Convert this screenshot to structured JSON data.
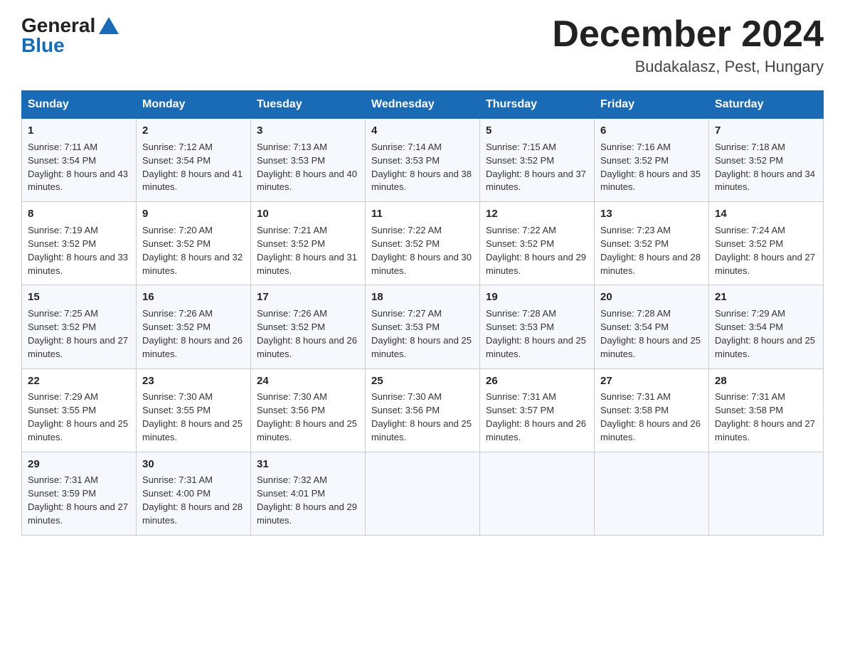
{
  "header": {
    "logo_general": "General",
    "logo_blue": "Blue",
    "month_title": "December 2024",
    "location": "Budakalasz, Pest, Hungary"
  },
  "weekdays": [
    "Sunday",
    "Monday",
    "Tuesday",
    "Wednesday",
    "Thursday",
    "Friday",
    "Saturday"
  ],
  "weeks": [
    [
      {
        "day": "1",
        "sunrise": "7:11 AM",
        "sunset": "3:54 PM",
        "daylight": "8 hours and 43 minutes."
      },
      {
        "day": "2",
        "sunrise": "7:12 AM",
        "sunset": "3:54 PM",
        "daylight": "8 hours and 41 minutes."
      },
      {
        "day": "3",
        "sunrise": "7:13 AM",
        "sunset": "3:53 PM",
        "daylight": "8 hours and 40 minutes."
      },
      {
        "day": "4",
        "sunrise": "7:14 AM",
        "sunset": "3:53 PM",
        "daylight": "8 hours and 38 minutes."
      },
      {
        "day": "5",
        "sunrise": "7:15 AM",
        "sunset": "3:52 PM",
        "daylight": "8 hours and 37 minutes."
      },
      {
        "day": "6",
        "sunrise": "7:16 AM",
        "sunset": "3:52 PM",
        "daylight": "8 hours and 35 minutes."
      },
      {
        "day": "7",
        "sunrise": "7:18 AM",
        "sunset": "3:52 PM",
        "daylight": "8 hours and 34 minutes."
      }
    ],
    [
      {
        "day": "8",
        "sunrise": "7:19 AM",
        "sunset": "3:52 PM",
        "daylight": "8 hours and 33 minutes."
      },
      {
        "day": "9",
        "sunrise": "7:20 AM",
        "sunset": "3:52 PM",
        "daylight": "8 hours and 32 minutes."
      },
      {
        "day": "10",
        "sunrise": "7:21 AM",
        "sunset": "3:52 PM",
        "daylight": "8 hours and 31 minutes."
      },
      {
        "day": "11",
        "sunrise": "7:22 AM",
        "sunset": "3:52 PM",
        "daylight": "8 hours and 30 minutes."
      },
      {
        "day": "12",
        "sunrise": "7:22 AM",
        "sunset": "3:52 PM",
        "daylight": "8 hours and 29 minutes."
      },
      {
        "day": "13",
        "sunrise": "7:23 AM",
        "sunset": "3:52 PM",
        "daylight": "8 hours and 28 minutes."
      },
      {
        "day": "14",
        "sunrise": "7:24 AM",
        "sunset": "3:52 PM",
        "daylight": "8 hours and 27 minutes."
      }
    ],
    [
      {
        "day": "15",
        "sunrise": "7:25 AM",
        "sunset": "3:52 PM",
        "daylight": "8 hours and 27 minutes."
      },
      {
        "day": "16",
        "sunrise": "7:26 AM",
        "sunset": "3:52 PM",
        "daylight": "8 hours and 26 minutes."
      },
      {
        "day": "17",
        "sunrise": "7:26 AM",
        "sunset": "3:52 PM",
        "daylight": "8 hours and 26 minutes."
      },
      {
        "day": "18",
        "sunrise": "7:27 AM",
        "sunset": "3:53 PM",
        "daylight": "8 hours and 25 minutes."
      },
      {
        "day": "19",
        "sunrise": "7:28 AM",
        "sunset": "3:53 PM",
        "daylight": "8 hours and 25 minutes."
      },
      {
        "day": "20",
        "sunrise": "7:28 AM",
        "sunset": "3:54 PM",
        "daylight": "8 hours and 25 minutes."
      },
      {
        "day": "21",
        "sunrise": "7:29 AM",
        "sunset": "3:54 PM",
        "daylight": "8 hours and 25 minutes."
      }
    ],
    [
      {
        "day": "22",
        "sunrise": "7:29 AM",
        "sunset": "3:55 PM",
        "daylight": "8 hours and 25 minutes."
      },
      {
        "day": "23",
        "sunrise": "7:30 AM",
        "sunset": "3:55 PM",
        "daylight": "8 hours and 25 minutes."
      },
      {
        "day": "24",
        "sunrise": "7:30 AM",
        "sunset": "3:56 PM",
        "daylight": "8 hours and 25 minutes."
      },
      {
        "day": "25",
        "sunrise": "7:30 AM",
        "sunset": "3:56 PM",
        "daylight": "8 hours and 25 minutes."
      },
      {
        "day": "26",
        "sunrise": "7:31 AM",
        "sunset": "3:57 PM",
        "daylight": "8 hours and 26 minutes."
      },
      {
        "day": "27",
        "sunrise": "7:31 AM",
        "sunset": "3:58 PM",
        "daylight": "8 hours and 26 minutes."
      },
      {
        "day": "28",
        "sunrise": "7:31 AM",
        "sunset": "3:58 PM",
        "daylight": "8 hours and 27 minutes."
      }
    ],
    [
      {
        "day": "29",
        "sunrise": "7:31 AM",
        "sunset": "3:59 PM",
        "daylight": "8 hours and 27 minutes."
      },
      {
        "day": "30",
        "sunrise": "7:31 AM",
        "sunset": "4:00 PM",
        "daylight": "8 hours and 28 minutes."
      },
      {
        "day": "31",
        "sunrise": "7:32 AM",
        "sunset": "4:01 PM",
        "daylight": "8 hours and 29 minutes."
      },
      null,
      null,
      null,
      null
    ]
  ]
}
